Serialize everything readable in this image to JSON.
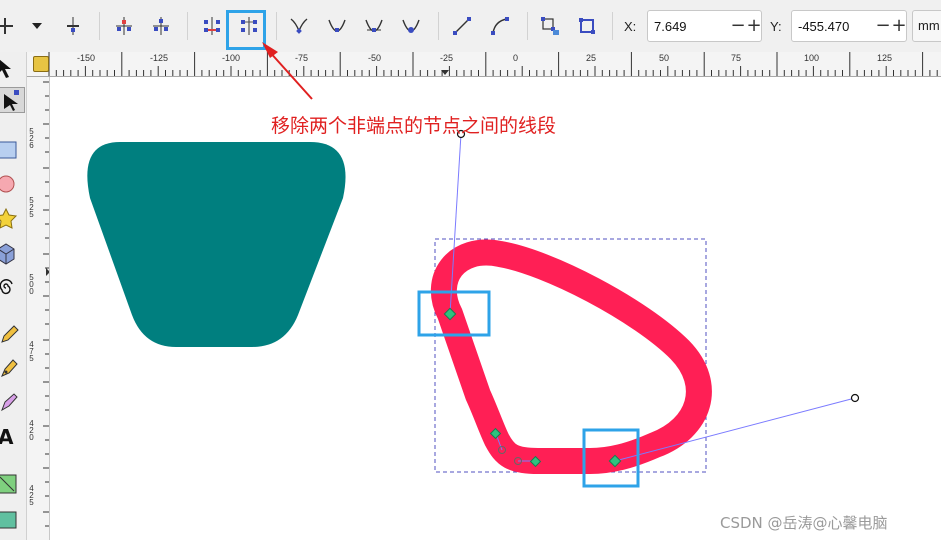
{
  "toolbar": {
    "buttons": [
      {
        "name": "insert-node-button",
        "icon": "insert-node-icon"
      },
      {
        "name": "insert-node-menu-button",
        "icon": "chevron-down-icon"
      },
      {
        "name": "delete-node-button",
        "icon": "delete-node-icon"
      },
      {
        "name": "join-nodes-button",
        "icon": "join-nodes-icon"
      },
      {
        "name": "break-path-button",
        "icon": "break-path-icon"
      },
      {
        "name": "join-with-segment-button",
        "icon": "join-segment-icon"
      },
      {
        "name": "delete-segment-button",
        "icon": "delete-segment-icon"
      },
      {
        "name": "make-cusp-button",
        "icon": "cusp-node-icon"
      },
      {
        "name": "make-smooth-button",
        "icon": "smooth-node-icon"
      },
      {
        "name": "make-symmetric-button",
        "icon": "symmetric-node-icon"
      },
      {
        "name": "make-auto-smooth-button",
        "icon": "auto-smooth-node-icon"
      },
      {
        "name": "make-line-button",
        "icon": "line-segment-icon"
      },
      {
        "name": "make-curve-button",
        "icon": "curve-segment-icon"
      },
      {
        "name": "object-to-path-button",
        "icon": "object-to-path-icon"
      },
      {
        "name": "stroke-to-path-button",
        "icon": "stroke-to-path-icon"
      }
    ],
    "x_label": "X:",
    "x_value": "7.649",
    "y_label": "Y:",
    "y_value": "-455.470",
    "minus": "−",
    "plus": "+",
    "unit": "mm"
  },
  "ruler": {
    "h_labels": [
      "-150",
      "-125",
      "-100",
      "-75",
      "-50",
      "-25",
      "0",
      "25",
      "50",
      "75",
      "100",
      "125"
    ],
    "v_labels": [
      "5",
      "2",
      "6",
      "5",
      "2",
      "5",
      "5",
      "0",
      "0",
      "4",
      "7",
      "5",
      "4",
      "2",
      "0",
      "4",
      "2",
      "5"
    ]
  },
  "annotation": {
    "text": "移除两个非端点的节点之间的线段",
    "color": "#e02020",
    "highlight_color": "#2ea3e8"
  },
  "canvas": {
    "trapezoid_color": "#007f7f",
    "path_color": "#ff1f55",
    "node_color": "#2ec27e",
    "handle_line_color": "#7b7bff",
    "selection_dash_color": "#5050c0"
  },
  "watermark": "CSDN @岳涛@心馨电脑"
}
